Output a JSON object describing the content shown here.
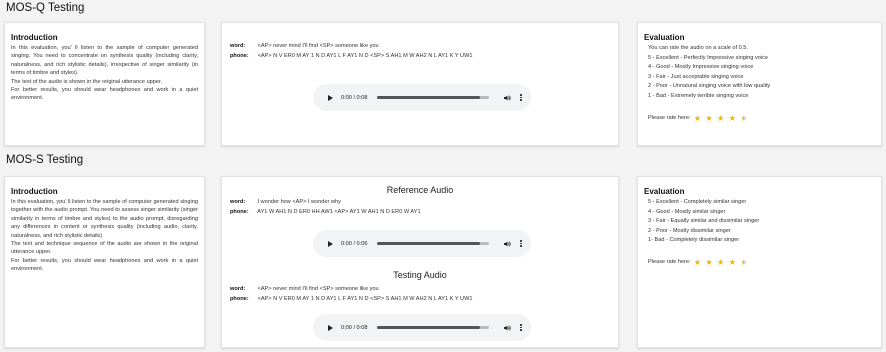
{
  "mosq": {
    "section_title": "MOS-Q Testing",
    "intro": {
      "title": "Introduction",
      "paragraphs": [
        "In this evaluation, you' ll listen to the sample of computer generated singing. You need to concentrate on synthesis quality (including clarity, naturalness, and rich stylistic details), irrespective of singer similarity (in terms of timbre and styles).",
        "The test of the audio is shown in the original utterance upper.",
        "For better results, you should wear headphones and work in a quiet environment."
      ]
    },
    "sample": {
      "word_label": "word:",
      "word_value": "<AP> never mind I'll find <SP> someone like you",
      "phone_label": "phone:",
      "phone_value": "<AP> N V ER0 M AY 1 N D AY1 L F AY1 N D <SP> S AH1 M W AH2 N L AY1 K Y UW1",
      "audio": {
        "time": "0:00 / 0:08",
        "progress": 0.92
      }
    },
    "evaluation": {
      "title": "Evaluation",
      "items": [
        "You can rate the audio on a scale of 0.5.",
        "5 - Excellent - Perfectly Impressive singing voice",
        "4 - Good - Mostly Impressive singing voice",
        "3 - Fair - Just acceptable singing voice",
        "2 - Poor - Unnatural singing voice with low quality",
        "1 - Bad - Extremely terrible singing voice"
      ],
      "rate_label": "Please rate here:",
      "rating": 4.5
    }
  },
  "moss": {
    "section_title": "MOS-S Testing",
    "intro": {
      "title": "Introduction",
      "paragraphs": [
        "In this evaluation, you' ll listen to the sample of computer generated singing together with the audio prompt. You need to assess singer similarity (singer similarity in terms of timbre and styles) to the audio prompt, disregarding any differences in content or synthesis quality (including audio, clarity, naturalness, and rich stylistic details)",
        "The text and technique sequence of the audio are shown in the original utterance upper.",
        "For better results, you should wear headphones and work in a quiet environment."
      ]
    },
    "reference": {
      "heading": "Reference Audio",
      "word_label": "word:",
      "word_value": "I wonder how <AP> I wonder why",
      "phone_label": "phone:",
      "phone_value": "AY1 W AH1 N D ER0 HH AW1 <AP> AY1 W AH1 N D ER0 W AY1",
      "audio": {
        "time": "0:00 / 0:06",
        "progress": 0.92
      }
    },
    "testing": {
      "heading": "Testing Audio",
      "word_label": "word:",
      "word_value": "<AP> never mind I'll find <SP> someone like you",
      "phone_label": "phone:",
      "phone_value": "<AP> N V ER0 M AY 1 N D AY1 L F AY1 N D <SP> S AH1 M W AH2 N L AY1 K Y UW1",
      "audio": {
        "time": "0:00 / 0:08",
        "progress": 0.92
      }
    },
    "evaluation": {
      "title": "Evaluation",
      "items": [
        "5 - Excellent - Completely similar singer",
        "4 - Good - Mostly similar singer",
        "3 - Fair - Equally similar and dissimilar singer",
        "2 - Poor - Mostly dissimilar singer",
        "1- Bad - Completely dissimilar singer"
      ],
      "rate_label": "Please rate here:",
      "rating": 4.5
    }
  },
  "icons": {
    "play": "play-icon",
    "volume": "volume-icon",
    "more": "more-vert-icon",
    "star": "star-icon"
  },
  "colors": {
    "star": "#f5b800",
    "player_bg": "#f1f3f4"
  }
}
